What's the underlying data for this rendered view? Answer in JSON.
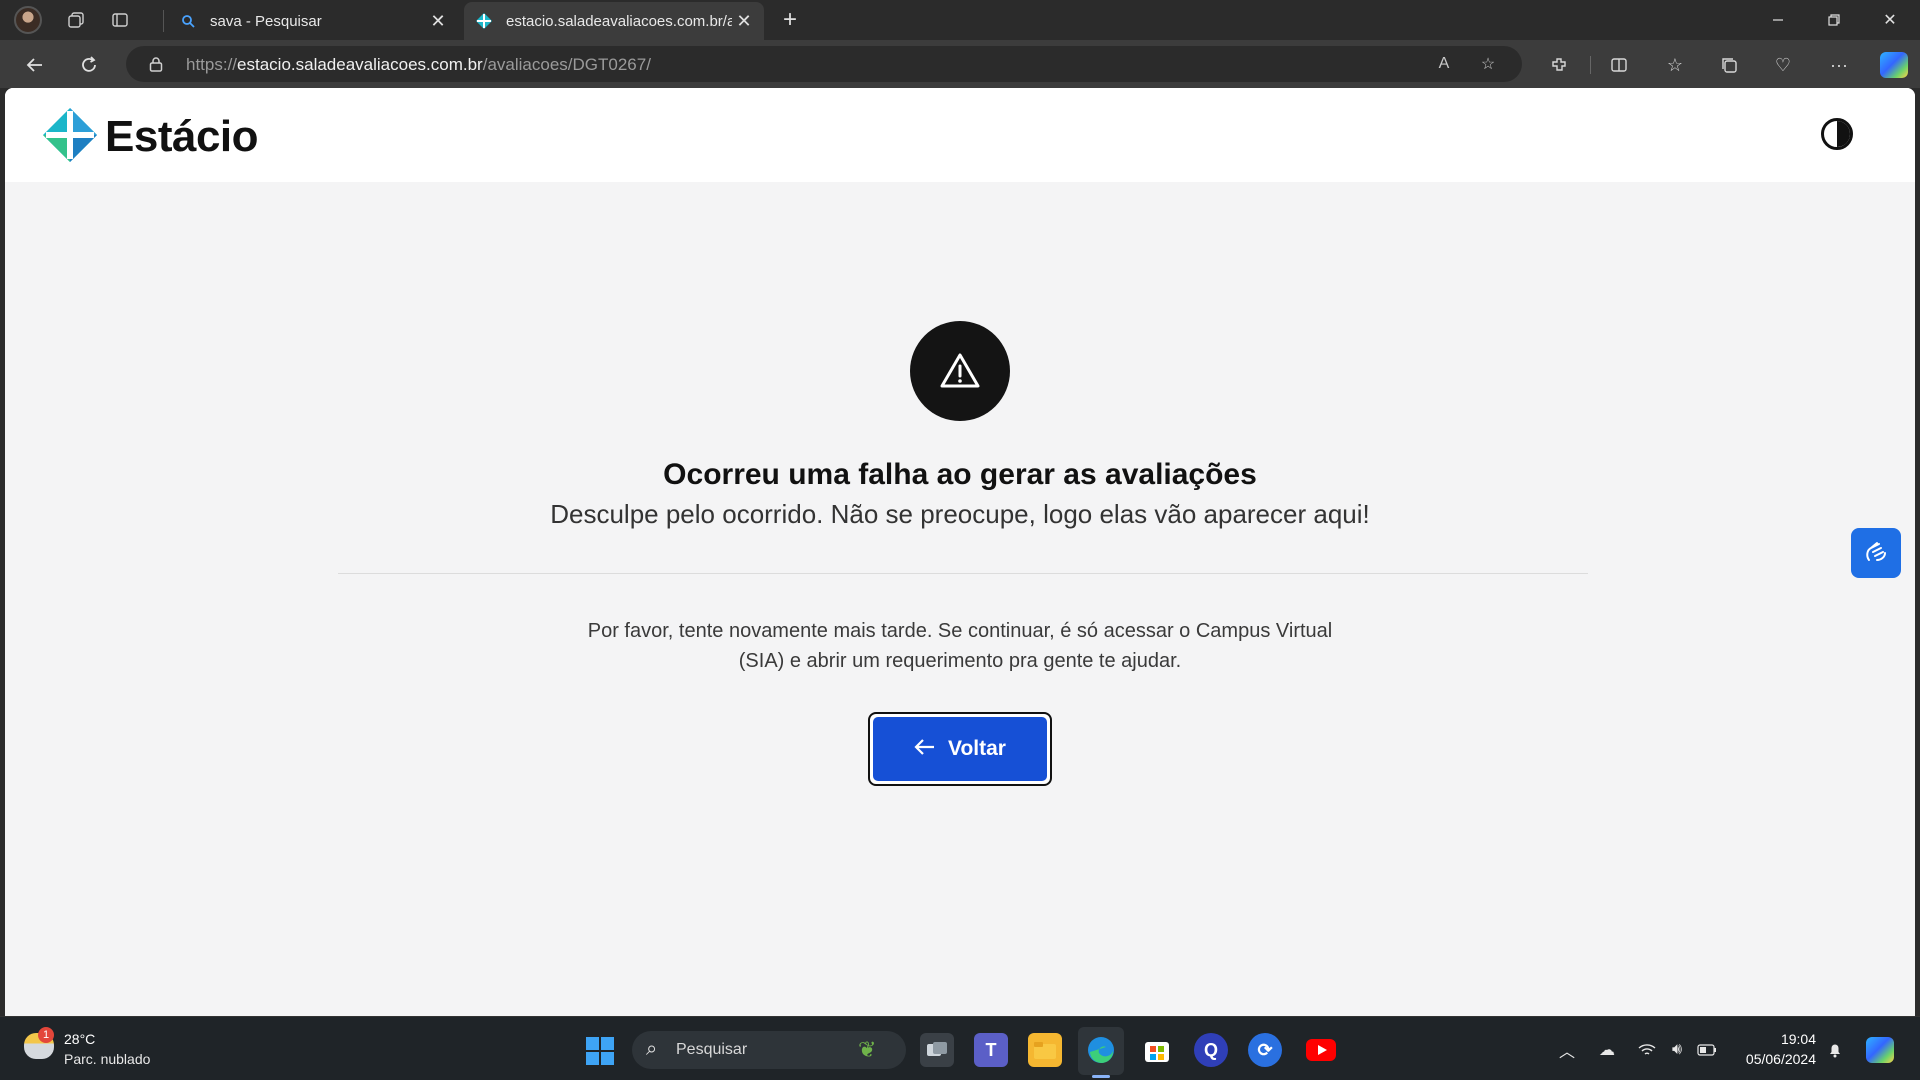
{
  "browser": {
    "tabs": [
      {
        "title": "sava - Pesquisar",
        "icon": "search-icon"
      },
      {
        "title": "estacio.saladeavaliacoes.com.br/a",
        "icon": "estacio-favicon",
        "active": true
      }
    ],
    "url_scheme": "https://",
    "url_host": "estacio.saladeavaliacoes.com.br",
    "url_path": "/avaliacoes/DGT0267/",
    "read_aloud_label": "A"
  },
  "site": {
    "brand": "Estácio",
    "brand_colors": {
      "teal": "#1bb6c9",
      "blue": "#2d6fc4",
      "green": "#33c28b"
    }
  },
  "error": {
    "title": "Ocorreu uma falha ao gerar as avaliações",
    "subtitle": "Desculpe pelo ocorrido. Não se preocupe, logo elas vão aparecer aqui!",
    "help": "Por favor, tente novamente mais tarde. Se continuar, é só acessar o Campus Virtual (SIA) e abrir um requerimento pra gente te ajudar.",
    "button_label": "Voltar",
    "button_color": "#1650d6"
  },
  "taskbar": {
    "weather": {
      "temp": "28°C",
      "desc": "Parc. nublado",
      "badge": "1"
    },
    "search_label": "Pesquisar",
    "time": "19:04",
    "date": "05/06/2024"
  }
}
